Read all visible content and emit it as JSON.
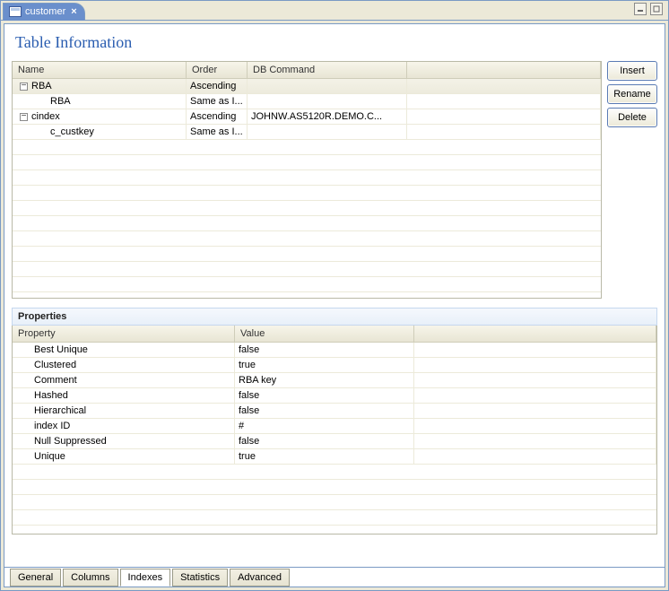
{
  "tab": {
    "title": "customer"
  },
  "heading": "Table Information",
  "buttons": {
    "insert": "Insert",
    "rename": "Rename",
    "delete": "Delete"
  },
  "grid": {
    "headers": {
      "name": "Name",
      "order": "Order",
      "db": "DB Command"
    },
    "rows": [
      {
        "type": "parent",
        "name": "RBA",
        "order": "Ascending",
        "db": "",
        "selected": true
      },
      {
        "type": "child",
        "name": "RBA",
        "order": "Same as I...",
        "db": ""
      },
      {
        "type": "parent",
        "name": "cindex",
        "order": "Ascending",
        "db": "JOHNW.AS5120R.DEMO.C..."
      },
      {
        "type": "child",
        "name": "c_custkey",
        "order": "Same as I...",
        "db": ""
      }
    ]
  },
  "propsHeader": "Properties",
  "propsColumns": {
    "prop": "Property",
    "val": "Value"
  },
  "props": [
    {
      "prop": "Best Unique",
      "val": "false"
    },
    {
      "prop": "Clustered",
      "val": "true"
    },
    {
      "prop": "Comment",
      "val": "RBA key"
    },
    {
      "prop": "Hashed",
      "val": "false"
    },
    {
      "prop": "Hierarchical",
      "val": "false"
    },
    {
      "prop": "index ID",
      "val": "#"
    },
    {
      "prop": "Null Suppressed",
      "val": "false"
    },
    {
      "prop": "Unique",
      "val": "true"
    }
  ],
  "bottomTabs": {
    "general": "General",
    "columns": "Columns",
    "indexes": "Indexes",
    "statistics": "Statistics",
    "advanced": "Advanced"
  }
}
